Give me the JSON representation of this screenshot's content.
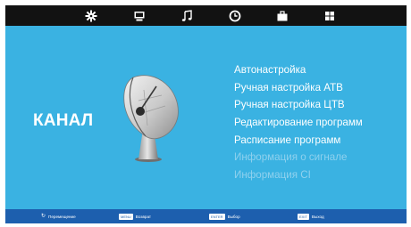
{
  "tabs": [
    {
      "icon": "gear-icon"
    },
    {
      "icon": "tv-icon"
    },
    {
      "icon": "music-note-icon"
    },
    {
      "icon": "clock-icon"
    },
    {
      "icon": "briefcase-icon"
    },
    {
      "icon": "grid-icon"
    }
  ],
  "page_title": "КАНАЛ",
  "menu": [
    {
      "label": "Автонастройка",
      "enabled": true
    },
    {
      "label": "Ручная настройка АТВ",
      "enabled": true
    },
    {
      "label": "Ручная настройка ЦТВ",
      "enabled": true
    },
    {
      "label": "Редактирование программ",
      "enabled": true
    },
    {
      "label": "Расписание программ",
      "enabled": true
    },
    {
      "label": "Информация о сигнале",
      "enabled": false
    },
    {
      "label": "Информация CI",
      "enabled": false
    }
  ],
  "hints": [
    {
      "key": "",
      "label": "Перемещение"
    },
    {
      "key": "MENU",
      "label": "Возврат"
    },
    {
      "key": "ENTER",
      "label": "Выбор"
    },
    {
      "key": "EXIT",
      "label": "Выход"
    }
  ],
  "colors": {
    "topbar": "#121212",
    "main": "#3ab2e2",
    "bottombar": "#1d5fae",
    "menu_enabled": "#ffffff",
    "menu_disabled": "#8fd1ee"
  }
}
